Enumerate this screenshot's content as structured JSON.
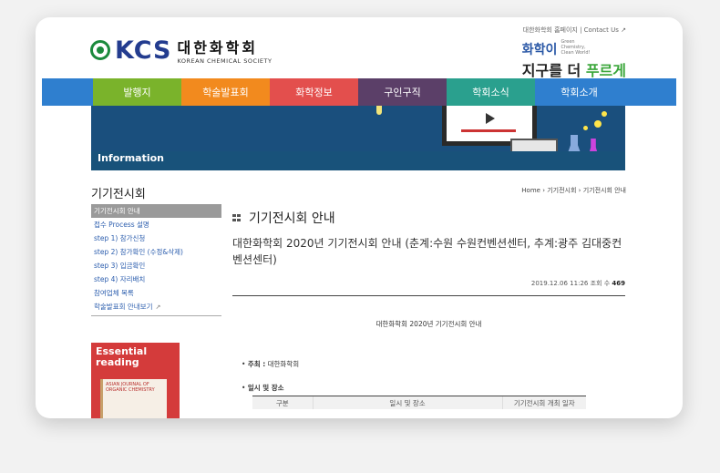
{
  "top_links": "대한화학회 홈페이지 | Contact Us",
  "logo": {
    "kcs": "KCS",
    "kr": "대한화학회",
    "en": "KOREAN CHEMICAL SOCIETY"
  },
  "slogan": {
    "line1": "화학이",
    "tag": "Green Chemistry, Clean World!",
    "line2_a": "지구를 더 ",
    "line2_b": "푸르게"
  },
  "nav": [
    {
      "label": "발행지",
      "color": "#7ab32b"
    },
    {
      "label": "학술발표회",
      "color": "#f28a1e"
    },
    {
      "label": "화학정보",
      "color": "#e34f4d"
    },
    {
      "label": "구인구직",
      "color": "#5b3f68"
    },
    {
      "label": "학회소식",
      "color": "#2aa08e"
    },
    {
      "label": "학회소개",
      "color": "#2f7fcf"
    }
  ],
  "hero": {
    "title": "Information"
  },
  "sidebar": {
    "title": "기기전시회",
    "items": [
      {
        "label": "기기전시회 안내",
        "active": true
      },
      {
        "label": "접수 Process 설명",
        "active": false
      },
      {
        "label": "step 1) 참가신청",
        "active": false
      },
      {
        "label": "step 2) 참가확인 (수정&삭제)",
        "active": false
      },
      {
        "label": "step 3) 입금확인",
        "active": false
      },
      {
        "label": "step 4) 자리배치",
        "active": false
      },
      {
        "label": "참여업체 목록",
        "active": false
      },
      {
        "label": "학술발표회 안내보기",
        "active": false
      }
    ],
    "banner_title": "Essential reading",
    "banner_journal": "ASIAN JOURNAL OF ORGANIC CHEMISTRY"
  },
  "breadcrumb": [
    "Home",
    "기기전시회",
    "기기전시회 안내"
  ],
  "main": {
    "section_title": "기기전시회 안내",
    "article_title": "대한화학회 2020년 기기전시회 안내 (춘계:수원 수원컨벤션센터, 추계:광주 김대중컨벤션센터)",
    "date": "2019.12.06 11:26",
    "views_label": "조회 수",
    "views": "469",
    "notice": "대한화학회 2020년 기기전시회 안내",
    "host_label": "주최 :",
    "host_value": "대한화학회",
    "schedule_label": "일시 및 장소",
    "table_headers": [
      "구분",
      "일시 및 장소",
      "기기전시회 개최 일자"
    ]
  }
}
